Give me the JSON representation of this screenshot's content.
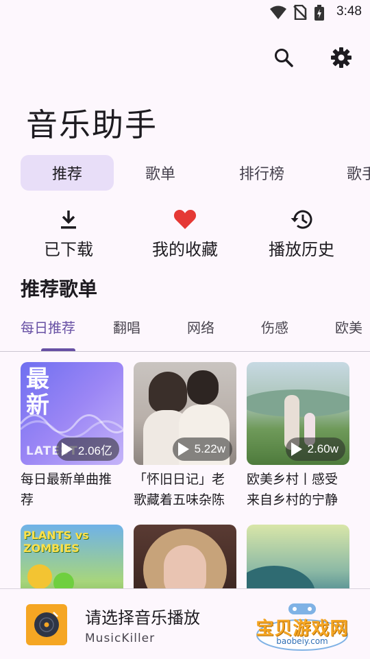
{
  "status_bar": {
    "time": "3:48"
  },
  "app": {
    "title": "音乐助手"
  },
  "tabs": [
    {
      "label": "推荐",
      "active": true
    },
    {
      "label": "歌单",
      "active": false
    },
    {
      "label": "排行榜",
      "active": false
    },
    {
      "label": "歌手",
      "active": false
    }
  ],
  "quick_actions": [
    {
      "label": "已下载",
      "icon": "download-icon"
    },
    {
      "label": "我的收藏",
      "icon": "heart-icon"
    },
    {
      "label": "播放历史",
      "icon": "history-icon"
    }
  ],
  "section": {
    "title": "推荐歌单"
  },
  "sub_tabs": [
    {
      "label": "每日推荐",
      "active": true
    },
    {
      "label": "翻唱",
      "active": false
    },
    {
      "label": "网络",
      "active": false
    },
    {
      "label": "伤感",
      "active": false
    },
    {
      "label": "欧美",
      "active": false
    }
  ],
  "playlists": [
    {
      "title": "每日最新单曲推荐",
      "play_count": "2.06亿",
      "cover_text": "最新",
      "cover_badge": "LATEST"
    },
    {
      "title": "「怀旧日记」老歌藏着五味杂陈",
      "play_count": "5.22w"
    },
    {
      "title": "欧美乡村丨感受来自乡村的宁静",
      "play_count": "2.60w"
    },
    {
      "title": "",
      "play_count": "",
      "cover_text": "PLANTS vs ZOMBIES"
    },
    {
      "title": "",
      "play_count": ""
    },
    {
      "title": "",
      "play_count": ""
    }
  ],
  "player": {
    "title": "请选择音乐播放",
    "subtitle": "MusicKiller"
  },
  "watermark": {
    "text": "宝贝游戏网",
    "url": "baobeiy.com"
  },
  "colors": {
    "accent": "#6750a4",
    "tab_active_bg": "#e8def8",
    "heart": "#e53935",
    "background": "#fdf7fd"
  }
}
